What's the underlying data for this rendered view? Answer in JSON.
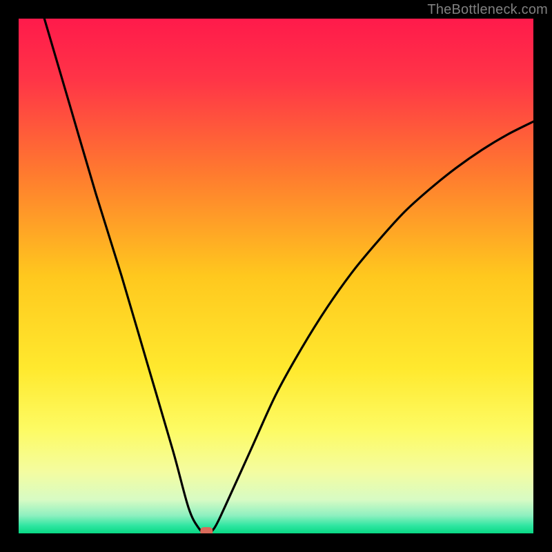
{
  "credit": "TheBottleneck.com",
  "chart_data": {
    "type": "line",
    "title": "",
    "xlabel": "",
    "ylabel": "",
    "xlim": [
      0,
      100
    ],
    "ylim": [
      0,
      100
    ],
    "background": "rainbow-vertical",
    "series": [
      {
        "name": "curve",
        "x": [
          5,
          10,
          15,
          20,
          25,
          30,
          33,
          35,
          36.5,
          38,
          40,
          45,
          50,
          55,
          60,
          65,
          70,
          75,
          80,
          85,
          90,
          95,
          100
        ],
        "y": [
          100,
          83,
          66,
          50,
          33,
          16,
          5,
          1,
          0,
          1,
          5,
          16,
          27,
          36,
          44,
          51,
          57,
          62.5,
          67,
          71,
          74.5,
          77.5,
          80
        ]
      }
    ],
    "marker": {
      "x": 36.5,
      "y": 0,
      "color": "#d96b5b"
    },
    "gradient_stops": [
      {
        "pos": 0.0,
        "color": "#ff1a4b"
      },
      {
        "pos": 0.12,
        "color": "#ff3547"
      },
      {
        "pos": 0.3,
        "color": "#ff7a2f"
      },
      {
        "pos": 0.5,
        "color": "#ffc81e"
      },
      {
        "pos": 0.68,
        "color": "#ffe92e"
      },
      {
        "pos": 0.8,
        "color": "#fdfb64"
      },
      {
        "pos": 0.88,
        "color": "#f4fca0"
      },
      {
        "pos": 0.935,
        "color": "#d7fbc4"
      },
      {
        "pos": 0.965,
        "color": "#8ff0c0"
      },
      {
        "pos": 0.985,
        "color": "#2fe6a1"
      },
      {
        "pos": 1.0,
        "color": "#08d884"
      }
    ]
  }
}
